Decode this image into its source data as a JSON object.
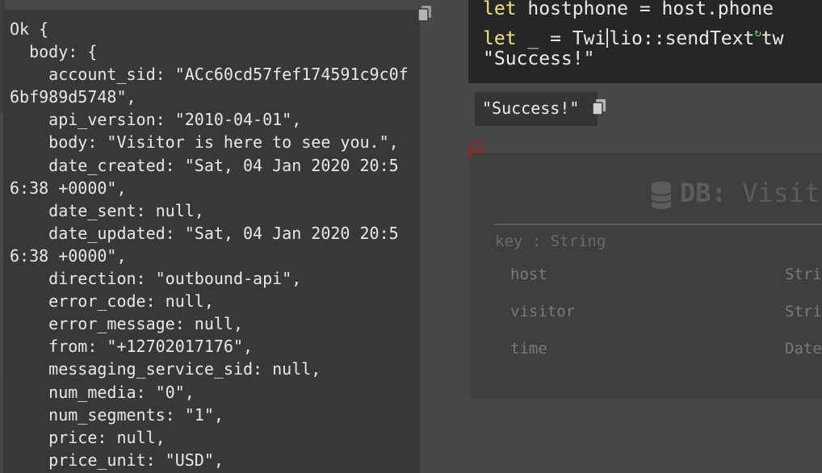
{
  "json_result": {
    "lines": [
      "Ok {",
      "  body: {",
      "    account_sid: \"ACc60cd57fef174591c9c0f6bf989d5748\",",
      "    api_version: \"2010-04-01\",",
      "    body: \"Visitor is here to see you.\",",
      "    date_created: \"Sat, 04 Jan 2020 20:56:38 +0000\",",
      "    date_sent: null,",
      "    date_updated: \"Sat, 04 Jan 2020 20:56:38 +0000\",",
      "    direction: \"outbound-api\",",
      "    error_code: null,",
      "    error_message: null,",
      "    from: \"+12702017176\",",
      "    messaging_service_sid: null,",
      "    num_media: \"0\",",
      "    num_segments: \"1\",",
      "    price: null,",
      "    price_unit: \"USD\","
    ],
    "copy_icon": "copy-icon"
  },
  "code_editor": {
    "line1": {
      "keyword": "let",
      "rest": " hostphone = host.phone"
    },
    "line2": {
      "keyword": "let",
      "pre_cursor": " _ = Twi",
      "post_cursor": "lio::sendText",
      "tail": "tw"
    },
    "line3": {
      "string": "\"Success!\""
    }
  },
  "result": {
    "value": "\"Success!\"",
    "copy_icon": "copy-icon"
  },
  "db": {
    "label": "DB:",
    "name": "Visit",
    "key_row": "key : String",
    "fields": [
      {
        "name": "host",
        "type": "Stri"
      },
      {
        "name": "visitor",
        "type": "Stri"
      },
      {
        "name": "time",
        "type": "Date"
      }
    ],
    "lock_icon": "lock-icon",
    "db_icon": "database-icon"
  },
  "colors": {
    "canvas": "#484848",
    "panel": "#383838",
    "editor": "#262626",
    "keyword": "#f6e27d",
    "string": "#c9a2e0",
    "lock": "#8a3a3a"
  }
}
